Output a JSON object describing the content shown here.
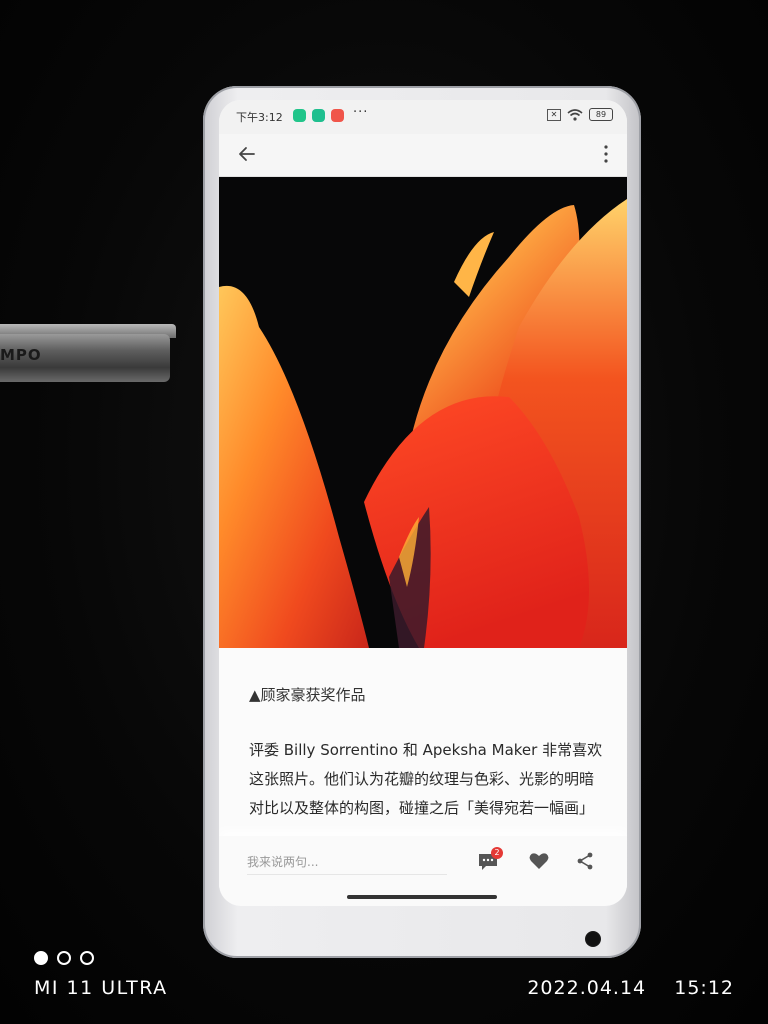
{
  "status_bar": {
    "time": "下午3:12",
    "app_icons": [
      {
        "name": "app-icon-green",
        "color": "#21c58a"
      },
      {
        "name": "app-icon-teal",
        "color": "#1fbf8f"
      },
      {
        "name": "app-icon-red",
        "color": "#f0554a"
      }
    ],
    "more": "···",
    "battery": "89"
  },
  "toolbar": {
    "back_icon": "arrow-left-icon",
    "more_icon": "vertical-dots-icon"
  },
  "article": {
    "caption": "▲顾家豪获奖作品",
    "body": "评委 Billy Sorrentino 和 Apeksha Maker 非常喜欢这张照片。他们认为花瓣的纹理与色彩、光影的明暗对比以及整体的构图，碰撞之后「美得宛若一幅画」"
  },
  "bottom_bar": {
    "comment_placeholder": "我来说两句...",
    "comment_count": "2",
    "icons": [
      "comment-icon",
      "heart-icon",
      "share-icon"
    ]
  },
  "pen": {
    "brand": "MPO"
  },
  "watermark": {
    "model": "MI 11 ULTRA",
    "date": "2022.04.14",
    "time": "15:12"
  },
  "colors": {
    "petal_red": "#e8361f",
    "petal_orange": "#f7a23a",
    "petal_yellow": "#ffd166",
    "badge": "#e53935"
  }
}
